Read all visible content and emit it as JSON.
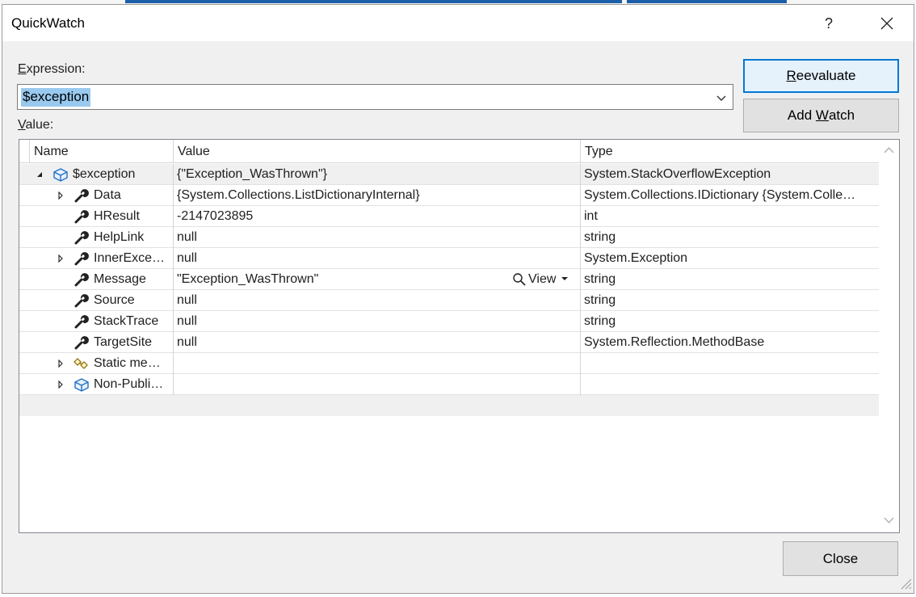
{
  "dialog": {
    "title": "QuickWatch",
    "help_label": "?"
  },
  "expression": {
    "label_accel": "E",
    "label_rest": "xpression:",
    "value": "$exception"
  },
  "value_label": {
    "accel": "V",
    "rest": "alue:"
  },
  "buttons": {
    "reevaluate_accel": "R",
    "reevaluate_rest": "eevaluate",
    "add_watch_pre": "Add ",
    "add_watch_accel": "W",
    "add_watch_rest": "atch",
    "close": "Close",
    "view": "View"
  },
  "grid": {
    "columns": [
      "Name",
      "Value",
      "Type"
    ],
    "rows": [
      {
        "name": "$exception",
        "value": "{\"Exception_WasThrown\"}",
        "type": "System.StackOverflowException",
        "icon": "object-icon",
        "expander": "expanded",
        "level": 0
      },
      {
        "name": "Data",
        "value": "{System.Collections.ListDictionaryInternal}",
        "type": "System.Collections.IDictionary {System.Colle…",
        "icon": "wrench-icon",
        "expander": "collapsed",
        "level": 1
      },
      {
        "name": "HResult",
        "value": "-2147023895",
        "type": "int",
        "icon": "wrench-icon",
        "expander": "none",
        "level": 1
      },
      {
        "name": "HelpLink",
        "value": "null",
        "type": "string",
        "icon": "wrench-icon",
        "expander": "none",
        "level": 1
      },
      {
        "name": "InnerExce…",
        "value": "null",
        "type": "System.Exception",
        "icon": "wrench-icon",
        "expander": "collapsed",
        "level": 1
      },
      {
        "name": "Message",
        "value": "\"Exception_WasThrown\"",
        "type": "string",
        "icon": "wrench-icon",
        "expander": "none",
        "level": 1
      },
      {
        "name": "Source",
        "value": "null",
        "type": "string",
        "icon": "wrench-icon",
        "expander": "none",
        "level": 1
      },
      {
        "name": "StackTrace",
        "value": "null",
        "type": "string",
        "icon": "wrench-icon",
        "expander": "none",
        "level": 1
      },
      {
        "name": "TargetSite",
        "value": "null",
        "type": "System.Reflection.MethodBase",
        "icon": "wrench-icon",
        "expander": "none",
        "level": 1
      },
      {
        "name": "Static me…",
        "value": "",
        "type": "",
        "icon": "static-members-icon",
        "expander": "collapsed",
        "level": 1
      },
      {
        "name": "Non-Publi…",
        "value": "",
        "type": "",
        "icon": "object-icon",
        "expander": "collapsed",
        "level": 1
      }
    ]
  },
  "colors": {
    "accent": "#0078d7",
    "selection": "#99c9ef"
  }
}
